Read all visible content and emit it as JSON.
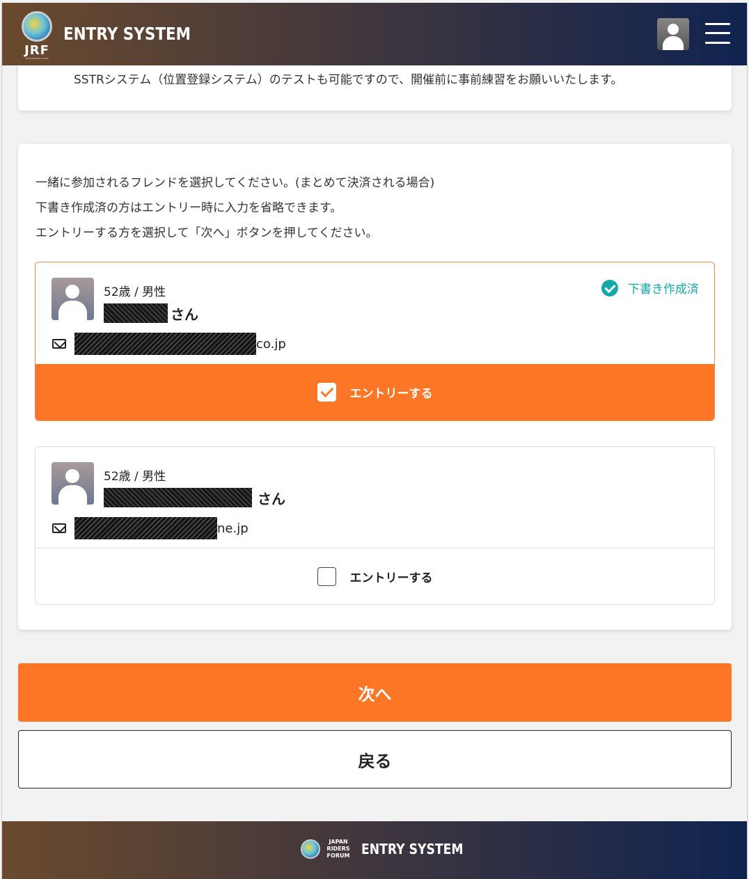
{
  "header": {
    "logo_text": "JRF",
    "logo_sub": "JAPAN RIDERS FORUM",
    "brand": "ENTRY SYSTEM"
  },
  "notice": {
    "text": "SSTRシステム（位置登録システム）のテストも可能ですので、開催前に事前練習をお願いいたします。"
  },
  "instructions": [
    "一緒に参加されるフレンドを選択してください。(まとめて決済される場合)",
    "下書き作成済の方はエントリー時に入力を省略できます。",
    "エントリーする方を選択して「次へ」ボタンを押してください。"
  ],
  "members": [
    {
      "age_gender": "52歳 / 男性",
      "name_suffix": "さん",
      "email_tail": "co.jp",
      "draft_label": "下書き作成済",
      "entry_label": "エントリーする",
      "checked": true
    },
    {
      "age_gender": "52歳 / 男性",
      "name_suffix": "さん",
      "email_tail": "ne.jp",
      "entry_label": "エントリーする",
      "checked": false
    }
  ],
  "buttons": {
    "next": "次へ",
    "back": "戻る"
  },
  "footer": {
    "jrf_line1": "JAPAN",
    "jrf_line2": "RIDERS",
    "jrf_line3": "FORUM",
    "brand": "ENTRY SYSTEM"
  },
  "colors": {
    "accent": "#fd7625",
    "draft": "#15a8a8"
  }
}
